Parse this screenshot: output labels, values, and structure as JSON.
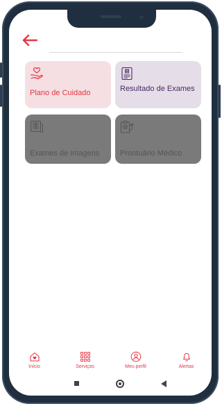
{
  "header": {
    "back_icon": "arrow-left-icon"
  },
  "colors": {
    "accent": "#e53744",
    "purple": "#4b2a63",
    "disabled": "#7a7a7a"
  },
  "cards": [
    {
      "label": "Plano de Cuidado",
      "icon": "care-hand-heart-icon"
    },
    {
      "label": "Resultado de Exames",
      "icon": "medical-report-icon"
    },
    {
      "label": "Exames de Imagens",
      "icon": "xray-images-icon"
    },
    {
      "label": "Prontuário Médico",
      "icon": "medical-record-stethoscope-icon"
    }
  ],
  "bottom_nav": [
    {
      "label": "Início",
      "icon": "home-heart-icon"
    },
    {
      "label": "Serviços",
      "icon": "grid-services-icon"
    },
    {
      "label": "Meu perfil",
      "icon": "user-profile-icon"
    },
    {
      "label": "Alertas",
      "icon": "bell-icon"
    }
  ],
  "system_nav": [
    "recent-apps-icon",
    "home-circle-icon",
    "back-triangle-icon"
  ]
}
